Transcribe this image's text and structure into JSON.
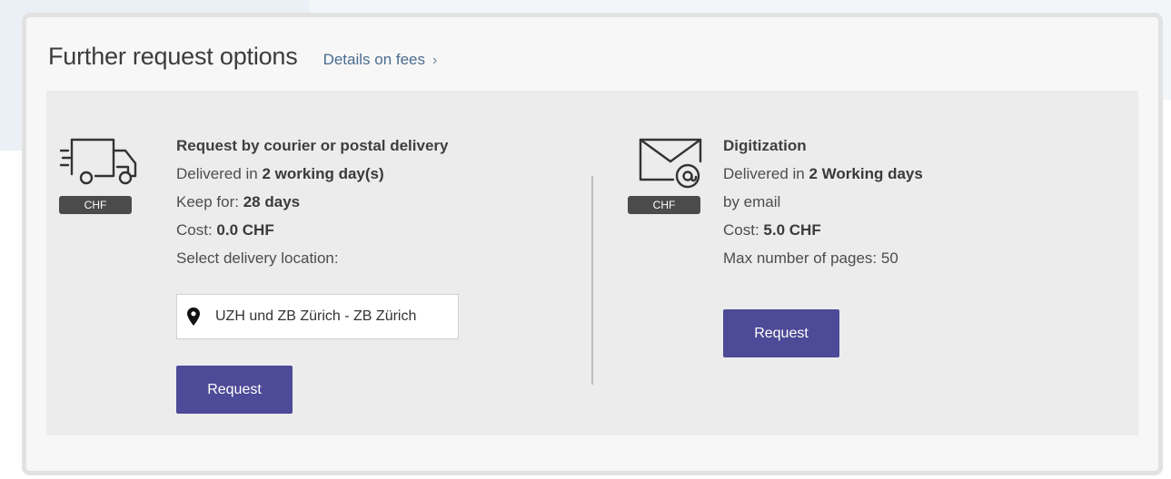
{
  "header": {
    "title": "Further request options",
    "fees_link": "Details on fees",
    "fees_chevron": "›"
  },
  "courier": {
    "icon": "delivery-truck-icon",
    "badge": "CHF",
    "heading": "Request by courier or postal delivery",
    "delivered_prefix": "Delivered in ",
    "delivered_value": "2 working day(s)",
    "keep_prefix": "Keep for: ",
    "keep_value": "28 days",
    "cost_prefix": "Cost:  ",
    "cost_value": "0.0  CHF",
    "location_label": "Select delivery location:",
    "location_icon": "map-pin-icon",
    "location_value": "UZH und ZB Zürich - ZB Zürich",
    "request_label": "Request"
  },
  "digitization": {
    "icon": "email-envelope-icon",
    "badge": "CHF",
    "heading": "Digitization",
    "delivered_prefix": "Delivered in ",
    "delivered_value": "2 Working days",
    "channel": "by email",
    "cost_prefix": "Cost:  ",
    "cost_value": "5.0  CHF",
    "max_pages": "Max number of pages: 50",
    "request_label": "Request"
  },
  "colors": {
    "button": "#4d4a97",
    "link": "#4a6c92",
    "badge": "#4b4b4b",
    "panel": "#f7f7f7",
    "inner": "#ececec"
  }
}
